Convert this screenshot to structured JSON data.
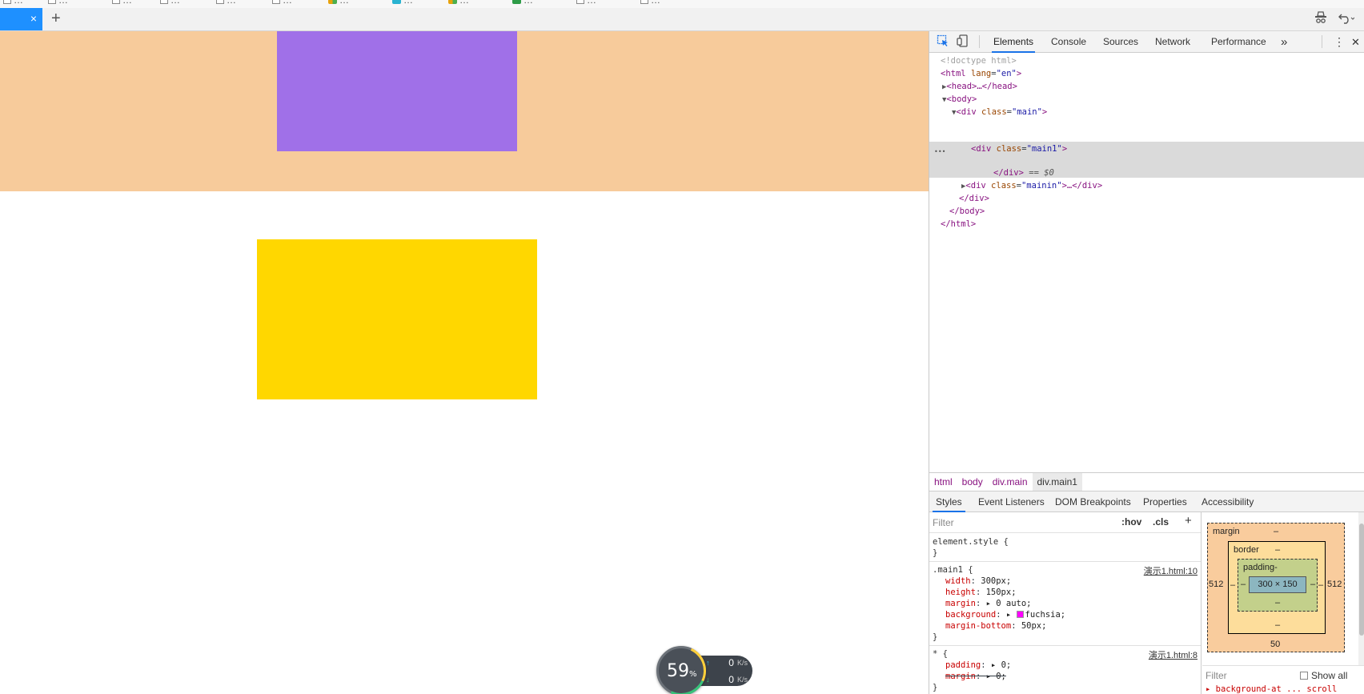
{
  "bookmarks": [
    {
      "label": "…",
      "icon": "box"
    },
    {
      "label": "…",
      "icon": "box"
    },
    {
      "label": "…",
      "icon": "box"
    },
    {
      "label": "…",
      "icon": "box"
    },
    {
      "label": "…",
      "icon": "box"
    },
    {
      "label": "…",
      "icon": "box"
    },
    {
      "label": "…",
      "icon": "multi"
    },
    {
      "label": "…",
      "icon": "cyan"
    },
    {
      "label": "…",
      "icon": "multi"
    },
    {
      "label": "…",
      "icon": "green"
    },
    {
      "label": "…",
      "icon": "box"
    },
    {
      "label": "…",
      "icon": "box"
    }
  ],
  "tabs": {
    "active_close": "×",
    "new_tab": "+"
  },
  "page": {
    "main_color": "#f7cb9b",
    "main1_color": "#a070e8",
    "mainin_color": "#ffd700"
  },
  "speed_widget": {
    "percent": "59",
    "percent_unit": "%",
    "upload_value": "0",
    "download_value": "0",
    "unit": "K/s",
    "up_arrow": "↑",
    "down_arrow": "↓"
  },
  "devtools": {
    "tabs": [
      "Elements",
      "Console",
      "Sources",
      "Network",
      "Performance"
    ],
    "more_tabs": "»",
    "menu": "⋮",
    "close": "✕",
    "dom": {
      "doctype": "<!doctype html>",
      "html_open_tag": "html",
      "html_lang_attr": "lang",
      "html_lang_val": "\"en\"",
      "head_collapsed": "<head>…</head>",
      "body_open": "<body>",
      "div_main_tag": "div",
      "class_attr": "class",
      "main_class_val": "\"main\"",
      "main1_class_val": "\"main1\"",
      "div_close_sel": "</div>",
      "dollar0": "== $0",
      "mainin_class_val": "\"mainin\"",
      "mainin_collapsed": "…</div>",
      "div_close": "</div>",
      "body_close": "</body>",
      "html_close": "</html>",
      "row_dots": "•••"
    },
    "breadcrumbs": [
      "html",
      "body",
      "div.main",
      "div.main1"
    ],
    "subtabs": [
      "Styles",
      "Event Listeners",
      "DOM Breakpoints",
      "Properties",
      "Accessibility"
    ],
    "styles": {
      "filter_placeholder": "Filter",
      "hov": ":hov",
      "cls": ".cls",
      "add": "+",
      "element_style": "element.style {",
      "close_brace": "}",
      "rule1_selector": ".main1 {",
      "rule1_source": "演示1.html:10",
      "rule1_props": [
        {
          "name": "width",
          "value": "300px;"
        },
        {
          "name": "height",
          "value": "150px;"
        },
        {
          "name": "margin",
          "value": "▸ 0 auto;"
        },
        {
          "name": "background",
          "value": "fuchsia;"
        },
        {
          "name": "margin-bottom",
          "value": "50px;"
        }
      ],
      "swatch_color": "#ff00ff",
      "rule2_selector": "* {",
      "rule2_source": "演示1.html:8",
      "rule2_props": [
        {
          "name": "padding",
          "value": "▸ 0;"
        },
        {
          "name": "margin",
          "value": "▸ 0;"
        }
      ]
    },
    "box_model": {
      "margin_label": "margin",
      "margin_top": "–",
      "margin_left": "512",
      "margin_right": "512",
      "margin_bottom": "50",
      "border_label": "border",
      "border_top": "–",
      "border_left": "–",
      "border_right": "–",
      "border_bottom": "–",
      "padding_label": "padding-",
      "padding_left": "–",
      "padding_right": "–",
      "padding_bottom": "–",
      "content": "300 × 150",
      "filter_placeholder": "Filter",
      "show_all": "Show all",
      "next_prop": "▸ background-at ... scroll"
    }
  }
}
